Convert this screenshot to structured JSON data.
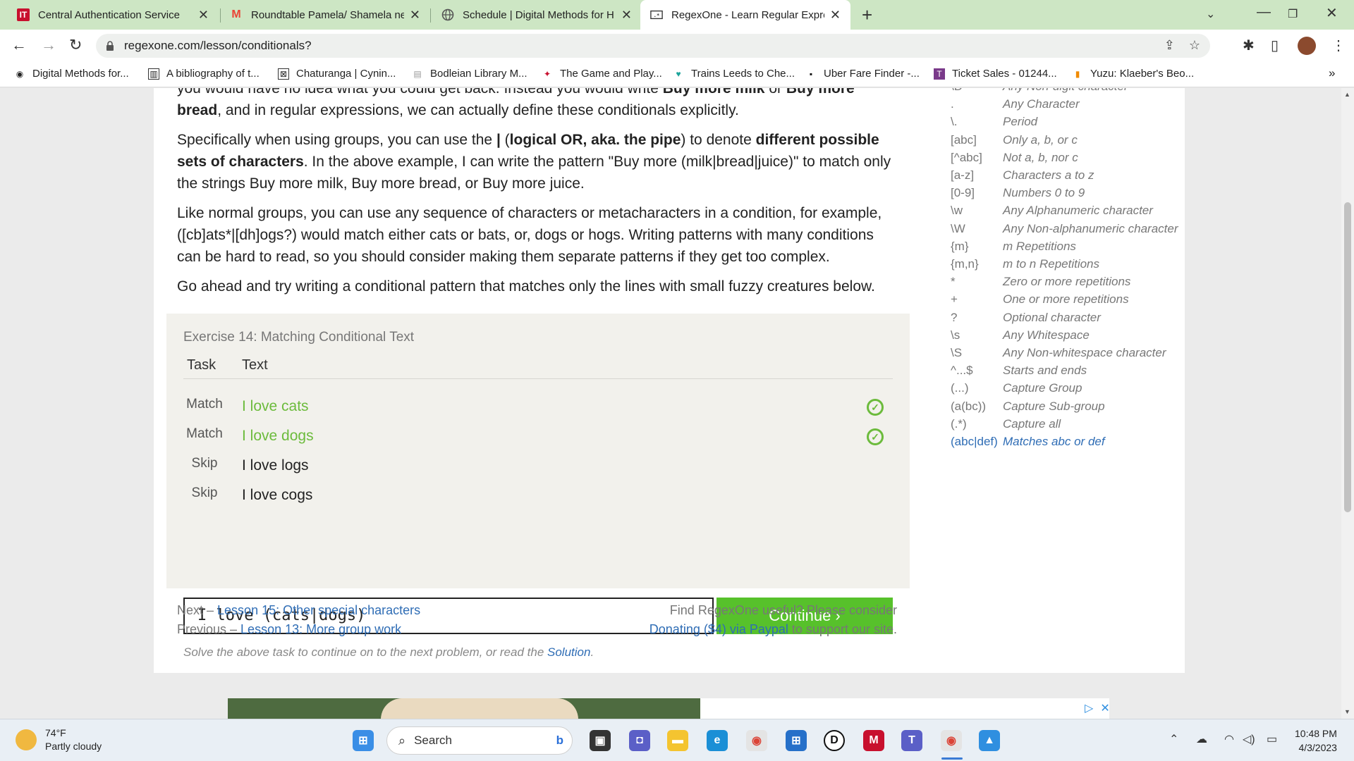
{
  "browser": {
    "tabs": [
      {
        "title": "Central Authentication Service",
        "favicon": "IT",
        "favicon_color": "#c8102e"
      },
      {
        "title": "Roundtable Pamela/ Shamela ne",
        "favicon": "M",
        "favicon_color": "#ea4335"
      },
      {
        "title": "Schedule | Digital Methods for H",
        "favicon": "globe",
        "favicon_color": "#555555"
      },
      {
        "title": "RegexOne - Learn Regular Expres",
        "favicon": "regex",
        "favicon_color": "#333333"
      }
    ],
    "url": "regexone.com/lesson/conditionals?",
    "bookmarks": [
      "Digital Methods for...",
      "A bibliography of t...",
      "Chaturanga | Cynin...",
      "Bodleian Library M...",
      "The Game and Play...",
      "Trains Leeds to Che...",
      "Uber Fare Finder -...",
      "Ticket Sales - 01244...",
      "Yuzu: Klaeber's Beo..."
    ],
    "bookmarks_more": "»"
  },
  "lesson": {
    "p1_a": "you would have no idea what you could get back. Instead you would write ",
    "p1_b1": "Buy more milk",
    "p1_c": " or ",
    "p1_b2": "Buy more bread",
    "p1_d": ", and in regular expressions, we can actually define these conditionals explicitly.",
    "p2_a": "Specifically when using groups, you can use the ",
    "p2_b1": "|",
    "p2_c": " (",
    "p2_b2": "logical OR, aka. the pipe",
    "p2_d": ") to denote ",
    "p2_b3": "different possible sets of characters",
    "p2_e": ". In the above example, I can write the pattern \"Buy more (milk|bread|juice)\" to match only the strings Buy more milk, Buy more bread, or Buy more juice.",
    "p3": "Like normal groups, you can use any sequence of characters or metacharacters in a condition, for example, ([cb]ats*|[dh]ogs?) would match either cats or bats, or, dogs or hogs. Writing patterns with many conditions can be hard to read, so you should consider making them separate patterns if they get too complex.",
    "p4": "Go ahead and try writing a conditional pattern that matches only the lines with small fuzzy creatures below."
  },
  "exercise": {
    "title": "Exercise 14: Matching Conditional Text",
    "col_task": "Task",
    "col_text": "Text",
    "rows": [
      {
        "task": "Match",
        "text": "I love cats",
        "done": true
      },
      {
        "task": "Match",
        "text": "I love dogs",
        "done": true
      },
      {
        "task": "Skip",
        "text": "I love logs",
        "done": false
      },
      {
        "task": "Skip",
        "text": "I love cogs",
        "done": false
      }
    ],
    "input_value": "I love (cats|dogs)",
    "continue_label": "Continue ›",
    "hint_a": "Solve the above task to continue on to the next problem, or read the ",
    "hint_link": "Solution",
    "hint_b": "."
  },
  "footer": {
    "next_prefix": "Next – ",
    "next_link": "Lesson 15: Other special characters",
    "prev_prefix": "Previous – ",
    "prev_link": "Lesson 13: More group work",
    "donate_line1": "Find RegexOne useful? Please consider",
    "donate_link": "Donating ($4) via Paypal",
    "donate_line2": " to support our site."
  },
  "cheatsheet": [
    {
      "pattern": "\\D",
      "desc": "Any Non-digit character"
    },
    {
      "pattern": ".",
      "desc": "Any Character"
    },
    {
      "pattern": "\\.",
      "desc": "Period"
    },
    {
      "pattern": "[abc]",
      "desc": "Only a, b, or c"
    },
    {
      "pattern": "[^abc]",
      "desc": "Not a, b, nor c"
    },
    {
      "pattern": "[a-z]",
      "desc": "Characters a to z"
    },
    {
      "pattern": "[0-9]",
      "desc": "Numbers 0 to 9"
    },
    {
      "pattern": "\\w",
      "desc": "Any Alphanumeric character"
    },
    {
      "pattern": "\\W",
      "desc": "Any Non-alphanumeric character"
    },
    {
      "pattern": "{m}",
      "desc": "m Repetitions"
    },
    {
      "pattern": "{m,n}",
      "desc": "m to n Repetitions"
    },
    {
      "pattern": "*",
      "desc": "Zero or more repetitions"
    },
    {
      "pattern": "+",
      "desc": "One or more repetitions"
    },
    {
      "pattern": "?",
      "desc": "Optional character"
    },
    {
      "pattern": "\\s",
      "desc": "Any Whitespace"
    },
    {
      "pattern": "\\S",
      "desc": "Any Non-whitespace character"
    },
    {
      "pattern": "^...$",
      "desc": "Starts and ends"
    },
    {
      "pattern": "(...)",
      "desc": "Capture Group"
    },
    {
      "pattern": "(a(bc))",
      "desc": "Capture Sub-group"
    },
    {
      "pattern": "(.*)",
      "desc": "Capture all"
    },
    {
      "pattern": "(abc|def)",
      "desc": "Matches abc or def",
      "highlight": true
    }
  ],
  "taskbar": {
    "temperature": "74°F",
    "condition": "Partly cloudy",
    "search_label": "Search",
    "time": "10:48 PM",
    "date": "4/3/2023"
  },
  "colors": {
    "tabstrip": "#cde6c4",
    "success": "#6cbb3c",
    "continue": "#57c12b",
    "link": "#2f6db5"
  }
}
